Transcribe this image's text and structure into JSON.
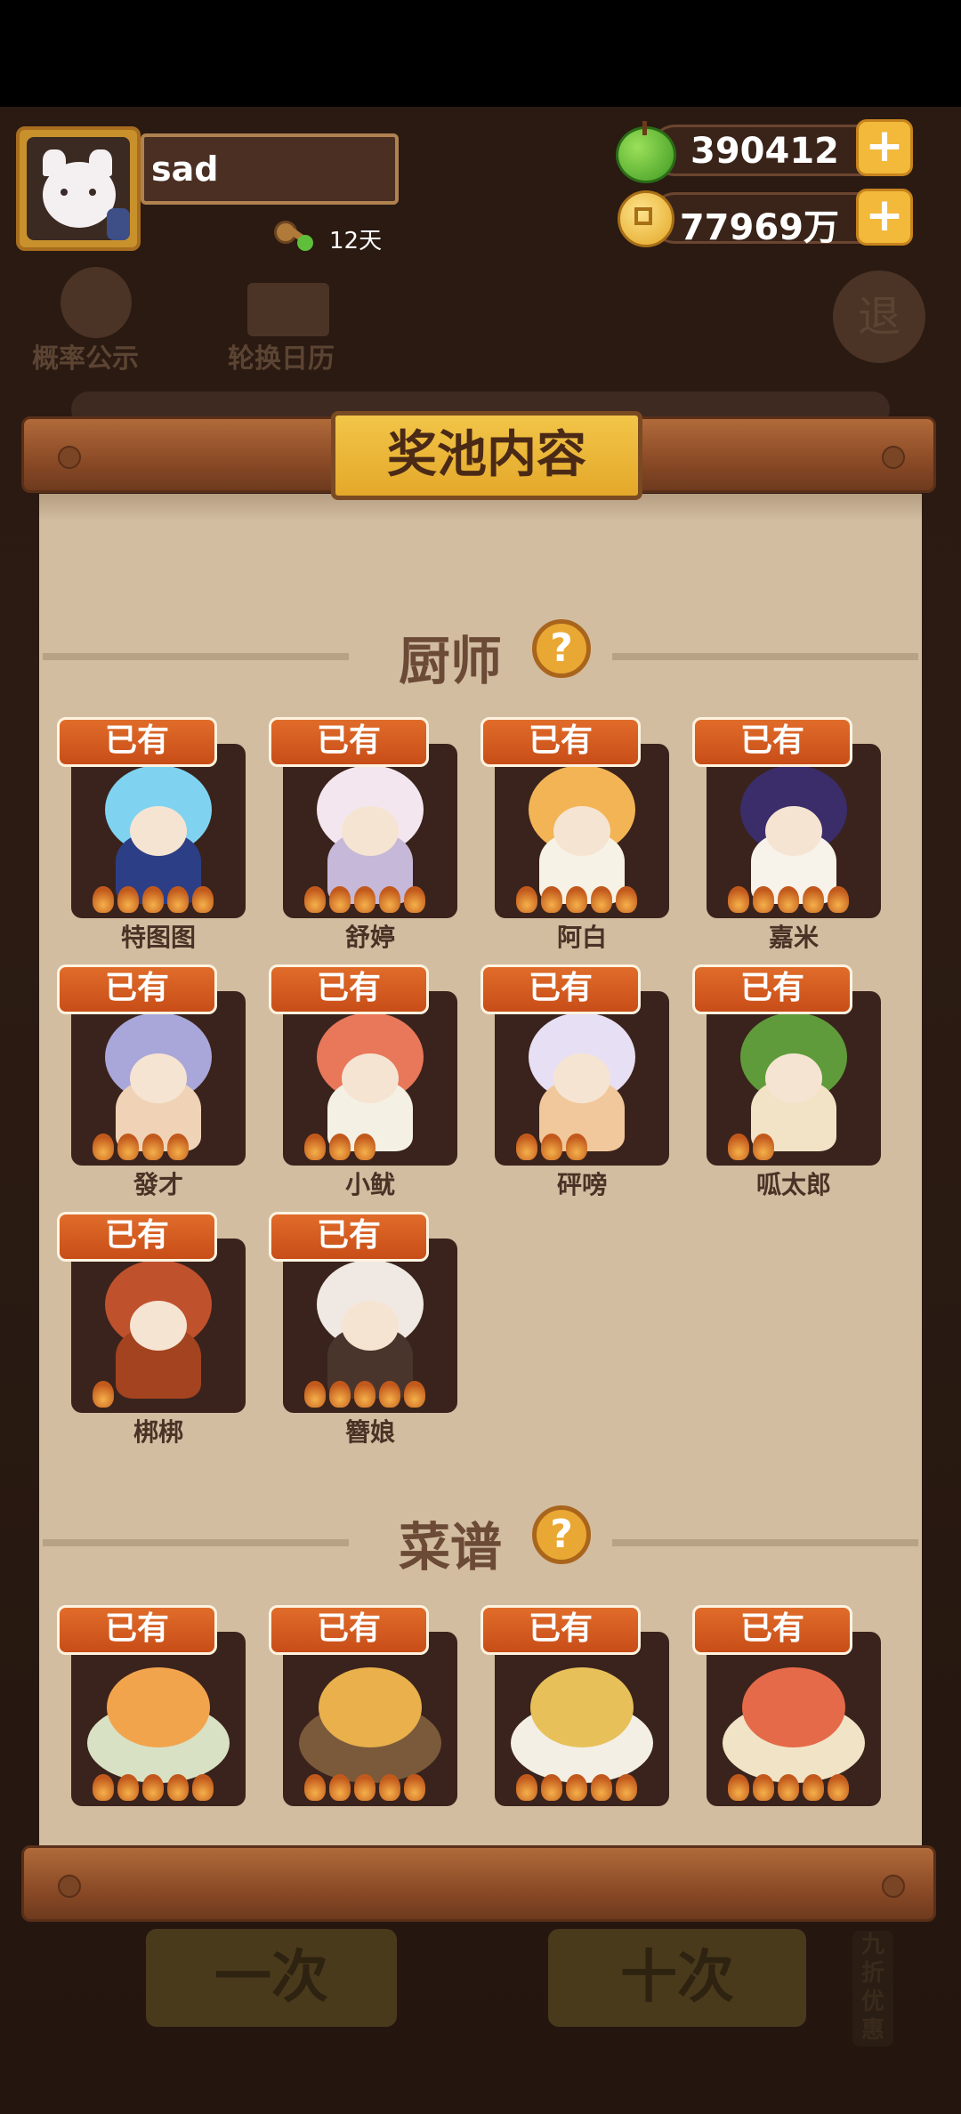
{
  "header": {
    "player_name": "sad",
    "days": "12天",
    "apples": "390412",
    "coins": "77969万",
    "add_label": "+"
  },
  "background_buttons": {
    "probability": "概率公示",
    "calendar": "轮换日历",
    "exit": "退",
    "draw_one": "一次",
    "draw_ten": "十次",
    "discount": "九折优惠"
  },
  "panel": {
    "title": "奖池内容",
    "help_label": "?",
    "owned_label": "已有",
    "chef_section": "厨师",
    "recipe_section": "菜谱"
  },
  "chefs": [
    {
      "name": "特图图",
      "hair": "#7fd3f0",
      "body": "#2c3f86",
      "stars": 5
    },
    {
      "name": "舒婷",
      "hair": "#f4e6ef",
      "body": "#c6b8d8",
      "stars": 5
    },
    {
      "name": "阿白",
      "hair": "#f2b455",
      "body": "#f6f2e6",
      "stars": 5
    },
    {
      "name": "嘉米",
      "hair": "#3b2c6a",
      "body": "#f7f2ea",
      "stars": 5
    },
    {
      "name": "發才",
      "hair": "#a9a7d9",
      "body": "#f0d3b6",
      "stars": 4
    },
    {
      "name": "小鱿",
      "hair": "#e9775a",
      "body": "#f4f0e4",
      "stars": 3
    },
    {
      "name": "砰嗙",
      "hair": "#e7e0f4",
      "body": "#f1c79c",
      "stars": 3
    },
    {
      "name": "呱太郎",
      "hair": "#5f9b3b",
      "body": "#f2e3c7",
      "stars": 2
    },
    {
      "name": "梆梆",
      "hair": "#c0512d",
      "body": "#a3431f",
      "stars": 1
    },
    {
      "name": "簪娘",
      "hair": "#f0e9e3",
      "body": "#4a352c",
      "stars": 5
    }
  ],
  "recipes": [
    {
      "plate": "#d9e1c4",
      "food": "#f2a44d",
      "stars": 5
    },
    {
      "plate": "#7a5a3a",
      "food": "#e9b04c",
      "stars": 5
    },
    {
      "plate": "#f3efe4",
      "food": "#e8c05a",
      "stars": 5
    },
    {
      "plate": "#f1e3c6",
      "food": "#e56a4a",
      "stars": 5
    }
  ],
  "colors": {
    "owned_badge": "#d85e20",
    "paper": "#d2bda1",
    "rod": "#9a5a30",
    "card_bg": "#3a231c"
  }
}
